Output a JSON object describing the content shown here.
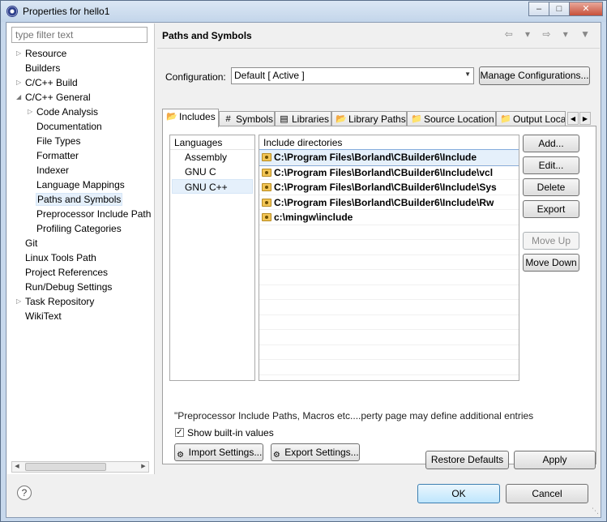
{
  "window": {
    "title": "Properties for hello1",
    "min_glyph": "–",
    "max_glyph": "□",
    "close_glyph": "✕"
  },
  "filter": {
    "placeholder": "type filter text"
  },
  "tree": [
    {
      "label": "Resource",
      "arrow": "▷"
    },
    {
      "label": "Builders"
    },
    {
      "label": "C/C++ Build",
      "arrow": "▷"
    },
    {
      "label": "C/C++ General",
      "arrow": "◢"
    },
    {
      "label": "Code Analysis",
      "arrow": "▷"
    },
    {
      "label": "Documentation"
    },
    {
      "label": "File Types"
    },
    {
      "label": "Formatter"
    },
    {
      "label": "Indexer"
    },
    {
      "label": "Language Mappings"
    },
    {
      "label": "Paths and Symbols"
    },
    {
      "label": "Preprocessor Include Path"
    },
    {
      "label": "Profiling Categories"
    },
    {
      "label": "Git"
    },
    {
      "label": "Linux Tools Path"
    },
    {
      "label": "Project References"
    },
    {
      "label": "Run/Debug Settings"
    },
    {
      "label": "Task Repository",
      "arrow": "▷"
    },
    {
      "label": "WikiText"
    }
  ],
  "page": {
    "heading": "Paths and Symbols",
    "nav": "⇦ ▾ ⇨ ▾ ▼"
  },
  "configuration": {
    "label": "Configuration:",
    "value": "Default  [ Active ]",
    "manage_label": "Manage Configurations..."
  },
  "tabs": [
    {
      "label": "Includes",
      "icon": "📂"
    },
    {
      "label": "Symbols",
      "icon": "#"
    },
    {
      "label": "Libraries",
      "icon": "▤"
    },
    {
      "label": "Library Paths",
      "icon": "📂"
    },
    {
      "label": "Source Location",
      "icon": "📁"
    },
    {
      "label": "Output Loca",
      "icon": "📁"
    }
  ],
  "languages": {
    "header": "Languages",
    "items": [
      "Assembly",
      "GNU C",
      "GNU C++"
    ]
  },
  "include_dirs": {
    "header": "Include directories",
    "items": [
      "C:\\Program Files\\Borland\\CBuilder6\\Include",
      "C:\\Program Files\\Borland\\CBuilder6\\Include\\vcl",
      "C:\\Program Files\\Borland\\CBuilder6\\Include\\Sys",
      "C:\\Program Files\\Borland\\CBuilder6\\Include\\Rw",
      "c:\\mingw\\include"
    ]
  },
  "side_buttons": {
    "add": "Add...",
    "edit": "Edit...",
    "delete": "Delete",
    "export": "Export",
    "move_up": "Move Up",
    "move_down": "Move Down"
  },
  "note": "\"Preprocessor Include Paths, Macros etc....perty page may define additional entries",
  "show_builtin": {
    "label": "Show built-in values",
    "checked": true
  },
  "import_label": "Import Settings...",
  "export_settings_label": "Export Settings...",
  "restore_defaults": "Restore Defaults",
  "apply": "Apply",
  "ok": "OK",
  "cancel": "Cancel",
  "help_glyph": "?"
}
